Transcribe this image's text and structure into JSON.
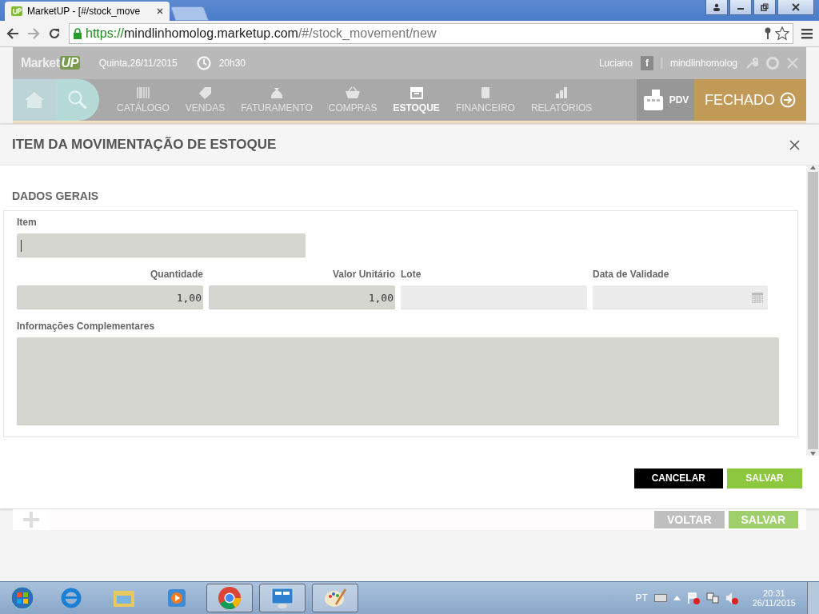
{
  "browser": {
    "tab_title": "MarketUP - [#/stock_move",
    "url_scheme": "https://",
    "url_host": "mindlinhomolog.marketup.com",
    "url_path": "/#/stock_movement/new"
  },
  "app_header": {
    "logo_text": "Market",
    "logo_badge": "UP",
    "date": "Quinta,26/11/2015",
    "time": "20h30",
    "user": "Luciano",
    "facebook": "f",
    "account": "mindlinhomolog"
  },
  "nav": {
    "items": [
      {
        "label": "CATÁLOGO",
        "selected": false
      },
      {
        "label": "VENDAS",
        "selected": false
      },
      {
        "label": "FATURAMENTO",
        "selected": false
      },
      {
        "label": "COMPRAS",
        "selected": false
      },
      {
        "label": "ESTOQUE",
        "selected": true
      },
      {
        "label": "FINANCEIRO",
        "selected": false
      },
      {
        "label": "RELATÓRIOS",
        "selected": false
      }
    ],
    "pdv": "PDV",
    "status": "FECHADO"
  },
  "modal": {
    "title": "ITEM DA MOVIMENTAÇÃO DE ESTOQUE",
    "section": "DADOS GERAIS",
    "item_field": {
      "label": "Item",
      "focused": true
    },
    "fields": [
      {
        "label": "Quantidade",
        "value": "1,00",
        "kind": "number"
      },
      {
        "label": "Valor Unitário",
        "value": "1,00",
        "kind": "number"
      },
      {
        "label": "Lote",
        "kind": "text"
      },
      {
        "label": "Data de Validade",
        "kind": "date"
      }
    ],
    "notes_label": "Informações Complementares",
    "buttons": [
      {
        "label": "CANCELAR",
        "kind": "dark"
      },
      {
        "label": "SALVAR",
        "kind": "primary"
      }
    ]
  },
  "background_buttons": [
    {
      "label": "VOLTAR",
      "kind": "grey"
    },
    {
      "label": "SALVAR",
      "kind": "green"
    }
  ],
  "taskbar": {
    "language": "PT",
    "time": "20:31",
    "date": "26/11/2015"
  }
}
